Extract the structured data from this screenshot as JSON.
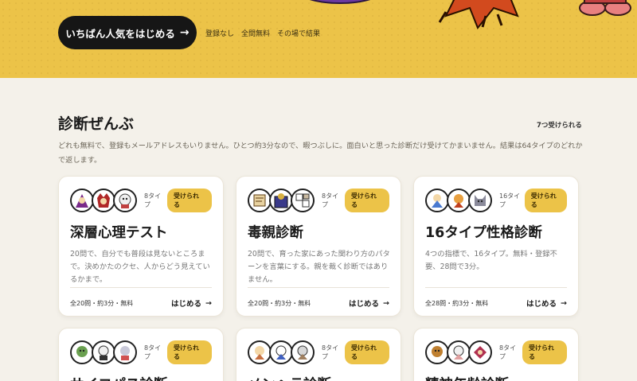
{
  "hero": {
    "cta_label": "いちばん人気をはじめる",
    "notes": [
      "登録なし",
      "全問無料",
      "その場で結果"
    ]
  },
  "section": {
    "title": "診断ぜんぶ",
    "count": "7つ受けられる",
    "description": "どれも無料で、登録もメールアドレスもいりません。ひとつ約3分なので、暇つぶしに。面白いと思った診断だけ受けてかまいません。結果は64タイプのどれかで返します。"
  },
  "cards": [
    {
      "types": "8タイプ",
      "badge": "受けられる",
      "title": "深層心理テスト",
      "desc": "20問で、自分でも普段は見ないところまで。決めかたのクセ、人からどう見えているかまで。",
      "meta": "全20問・約3分・無料",
      "start": "はじめる"
    },
    {
      "types": "8タイプ",
      "badge": "受けられる",
      "title": "毒親診断",
      "desc": "20問で、育った家にあった関わり方のパターンを言葉にする。親を裁く診断ではありません。",
      "meta": "全20問・約3分・無料",
      "start": "はじめる"
    },
    {
      "types": "16タイプ",
      "badge": "受けられる",
      "title": "16タイプ性格診断",
      "desc": "4つの指標で、16タイプ。無料・登録不要、28問で3分。",
      "meta": "全28問・約3分・無料",
      "start": "はじめる"
    },
    {
      "types": "8タイプ",
      "badge": "受けられる",
      "title": "サイコパス診断"
    },
    {
      "types": "8タイプ",
      "badge": "受けられる",
      "title": "メンヘラ診断"
    },
    {
      "types": "8タイプ",
      "badge": "受けられる",
      "title": "精神年齢診断"
    }
  ],
  "colors": {
    "accent": "#ecc348",
    "dark": "#161616",
    "bg": "#f4f1ea"
  }
}
